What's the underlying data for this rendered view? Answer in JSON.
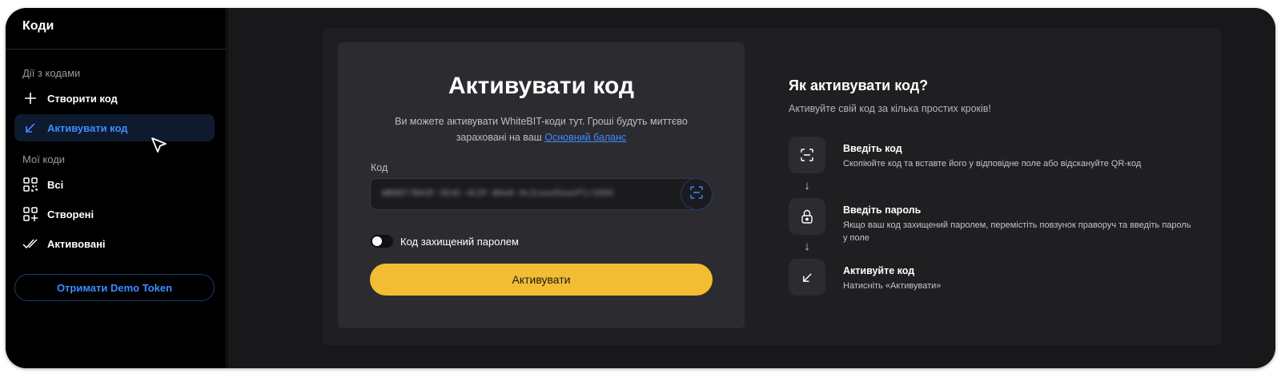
{
  "sidebar": {
    "title": "Коди",
    "sections": {
      "actions_label": "Дії з кодами",
      "my_codes_label": "Мої коди"
    },
    "items": [
      {
        "label": "Створити код",
        "icon": "plus-icon"
      },
      {
        "label": "Активувати код",
        "icon": "arrow-down-left-icon",
        "active": true
      },
      {
        "label": "Всі",
        "icon": "qr-code-icon"
      },
      {
        "label": "Створені",
        "icon": "qr-plus-icon"
      },
      {
        "label": "Активовані",
        "icon": "double-check-icon"
      }
    ],
    "demo_button": "Отримати Demo Token"
  },
  "activate_card": {
    "title": "Активувати код",
    "description": "Ви можете активувати WhiteBIT-коди тут. Гроші будуть миттєво зараховані на ваш",
    "balance_link": "Основний баланс",
    "code_label": "Код",
    "code_value": "WBDEF7BA3F-5E4C-4C2F-B6e8-9c2cea45ea4f1/USDC",
    "password_toggle_label": "Код захищений паролем",
    "password_toggle_on": false,
    "activate_button": "Активувати"
  },
  "how_to": {
    "title": "Як активувати код?",
    "subtitle": "Активуйте свій код за кілька простих кроків!",
    "steps": [
      {
        "title": "Введіть код",
        "description": "Скопіюйте код та вставте його у відповідне поле або відскануйте QR-код",
        "icon": "scan-icon"
      },
      {
        "title": "Введіть пароль",
        "description": "Якщо ваш код захищений паролем, перемістіть повзунок праворуч та введіть пароль у поле",
        "icon": "lock-icon"
      },
      {
        "title": "Активуйте код",
        "description": "Натисніть «Активувати»",
        "icon": "arrow-down-left-icon"
      }
    ],
    "arrow_glyph": "↓"
  },
  "colors": {
    "accent_blue": "#3d8bff",
    "button_yellow": "#f2bd33",
    "background": "#000000",
    "panel": "#1f1f22",
    "card": "#2c2c30"
  }
}
